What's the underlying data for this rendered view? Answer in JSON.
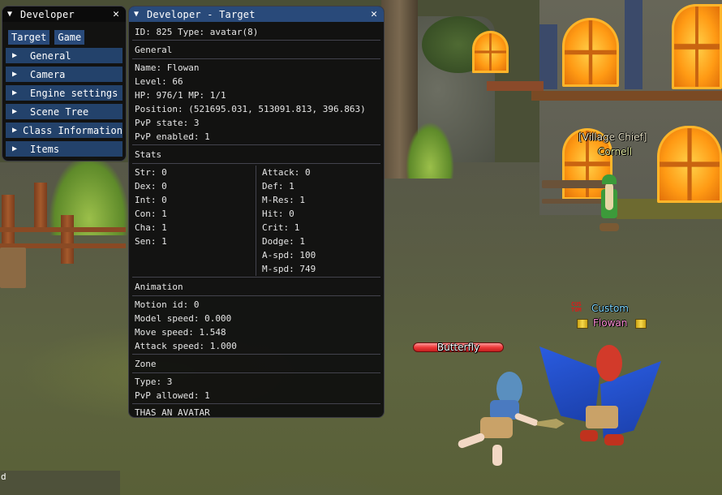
{
  "dev_window": {
    "title": "Developer",
    "tabs": [
      {
        "label": "Target"
      },
      {
        "label": "Game"
      }
    ],
    "sections": [
      {
        "label": "General"
      },
      {
        "label": "Camera"
      },
      {
        "label": "Engine settings"
      },
      {
        "label": "Scene Tree"
      },
      {
        "label": "Class Information"
      },
      {
        "label": "Items"
      }
    ],
    "colors": {
      "button": "#294a7a",
      "header": "#23426b",
      "window_bg": "#0f0f0f"
    }
  },
  "target_window": {
    "title": "Developer - Target",
    "id_line": "ID: 825 Type: avatar(8)",
    "general": {
      "header": "General",
      "rows": [
        "Name: Flowan",
        "Level: 66",
        "HP: 976/1 MP: 1/1",
        "Position: (521695.031, 513091.813, 396.863)",
        "PvP state: 3",
        "PvP enabled: 1"
      ]
    },
    "stats": {
      "header": "Stats",
      "left": [
        "Str: 0",
        "Dex: 0",
        "Int: 0",
        "Con: 1",
        "Cha: 1",
        "Sen: 1"
      ],
      "right": [
        "Attack: 0",
        "Def: 1",
        "M-Res: 1",
        "Hit: 0",
        "Crit: 1",
        "Dodge: 1",
        "A-spd: 100",
        "M-spd: 749"
      ]
    },
    "animation": {
      "header": "Animation",
      "rows": [
        "Motion id: 0",
        "Model speed: 0.000",
        "Move speed: 1.548",
        "Attack speed: 1.000"
      ]
    },
    "zone": {
      "header": "Zone",
      "rows": [
        "Type: 3",
        "PvP allowed: 1"
      ]
    },
    "footer": "THAS AN AVATAR"
  },
  "scene": {
    "npc": {
      "title": "[Village Chief]",
      "name": "Cornell"
    },
    "player": {
      "guild_emblem": [
        "CUS",
        "TOM"
      ],
      "guild": "Custom",
      "name": "Flowan"
    },
    "monster": {
      "name": "Butterfly",
      "hp_fraction": 1.0
    },
    "chat_fragment": "d"
  }
}
